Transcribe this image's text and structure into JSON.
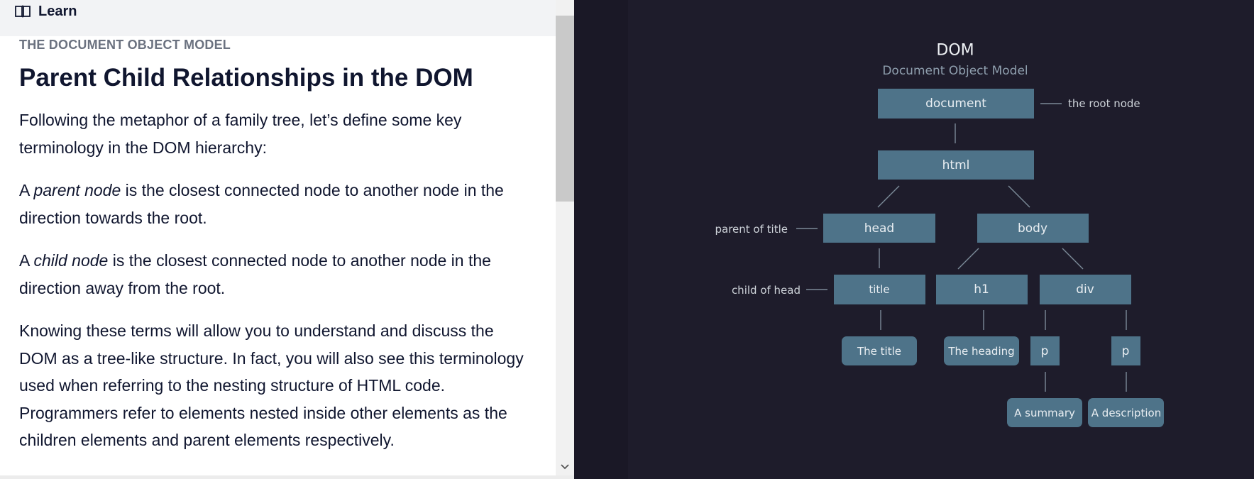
{
  "header": {
    "label": "Learn",
    "icon": "book-icon"
  },
  "article": {
    "eyebrow": "THE DOCUMENT OBJECT MODEL",
    "title": "Parent Child Relationships in the DOM",
    "p1": "Following the metaphor of a family tree, let’s define some key terminology in the DOM hierarchy:",
    "p2": {
      "pre": "A ",
      "term": "parent node",
      "post": " is the closest connected node to another node in the direction towards the root."
    },
    "p3": {
      "pre": "A ",
      "term": "child node",
      "post": " is the closest connected node to another node in the direction away from the root."
    },
    "p4": "Knowing these terms will allow you to understand and discuss the DOM as a tree-like structure. In fact, you will also see this terminology used when referring to the nesting structure of HTML code. Programmers refer to elements nested inside other elements as the children elements and parent elements respectively."
  },
  "diagram": {
    "title": "DOM",
    "subtitle": "Document Object Model",
    "nodes": {
      "document": "document",
      "html": "html",
      "head": "head",
      "body": "body",
      "title": "title",
      "h1": "h1",
      "div": "div",
      "p1": "p",
      "p2": "p",
      "the_title": "The title",
      "the_heading": "The heading",
      "a_summary": "A summary",
      "a_description": "A description"
    },
    "annotations": {
      "root": "the root node",
      "parent": "parent of title",
      "child": "child of head"
    },
    "colors": {
      "node": "#4e7389",
      "background": "#1e1c2b",
      "line": "#7b8a98"
    }
  },
  "scrollbar": {
    "down_icon": "chevron-down-icon"
  }
}
